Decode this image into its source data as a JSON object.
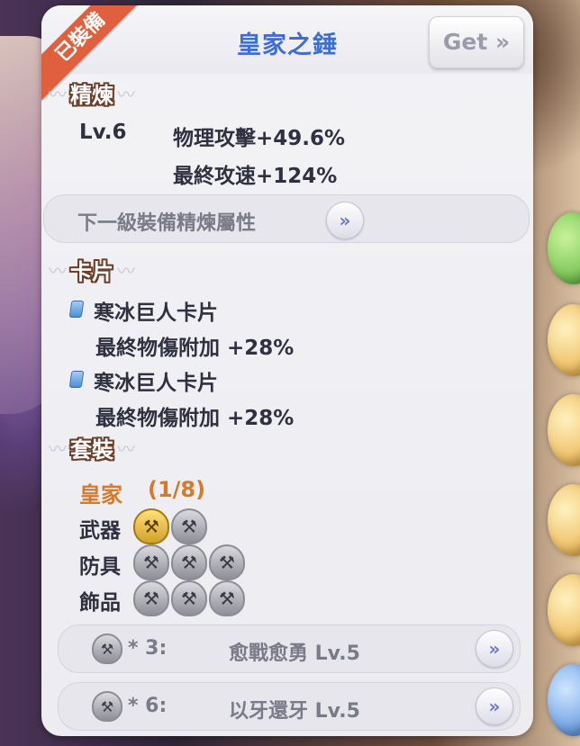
{
  "badge": "已裝備",
  "item": {
    "title": "皇家之錘",
    "get_label": "Get »"
  },
  "refine": {
    "heading": "精煉",
    "level": "Lv.6",
    "stats": [
      "物理攻擊+49.6%",
      "最終攻速+124%"
    ],
    "next_label": "下一級裝備精煉屬性"
  },
  "cards": {
    "heading": "卡片",
    "items": [
      {
        "name": "寒冰巨人卡片",
        "effect": "最終物傷附加 +28%"
      },
      {
        "name": "寒冰巨人卡片",
        "effect": "最終物傷附加 +28%"
      }
    ]
  },
  "set": {
    "heading": "套裝",
    "name": "皇家",
    "count": "(1/8)",
    "rows": [
      {
        "label": "武器",
        "equipped": 1,
        "total": 2
      },
      {
        "label": "防具",
        "equipped": 0,
        "total": 3
      },
      {
        "label": "飾品",
        "equipped": 0,
        "total": 3
      }
    ],
    "bonuses": [
      {
        "tier": "* 3:",
        "name": "愈戰愈勇 Lv.5"
      },
      {
        "tier": "* 6:",
        "name": "以牙還牙 Lv.5"
      }
    ]
  },
  "icons": {
    "arrow": "double-chevron-right-icon",
    "shield": "hammer-shield-icon",
    "card": "card-icon"
  },
  "colors": {
    "title": "#3c6fd1",
    "set_name": "#d47a2a",
    "badge": "#e0603e"
  }
}
